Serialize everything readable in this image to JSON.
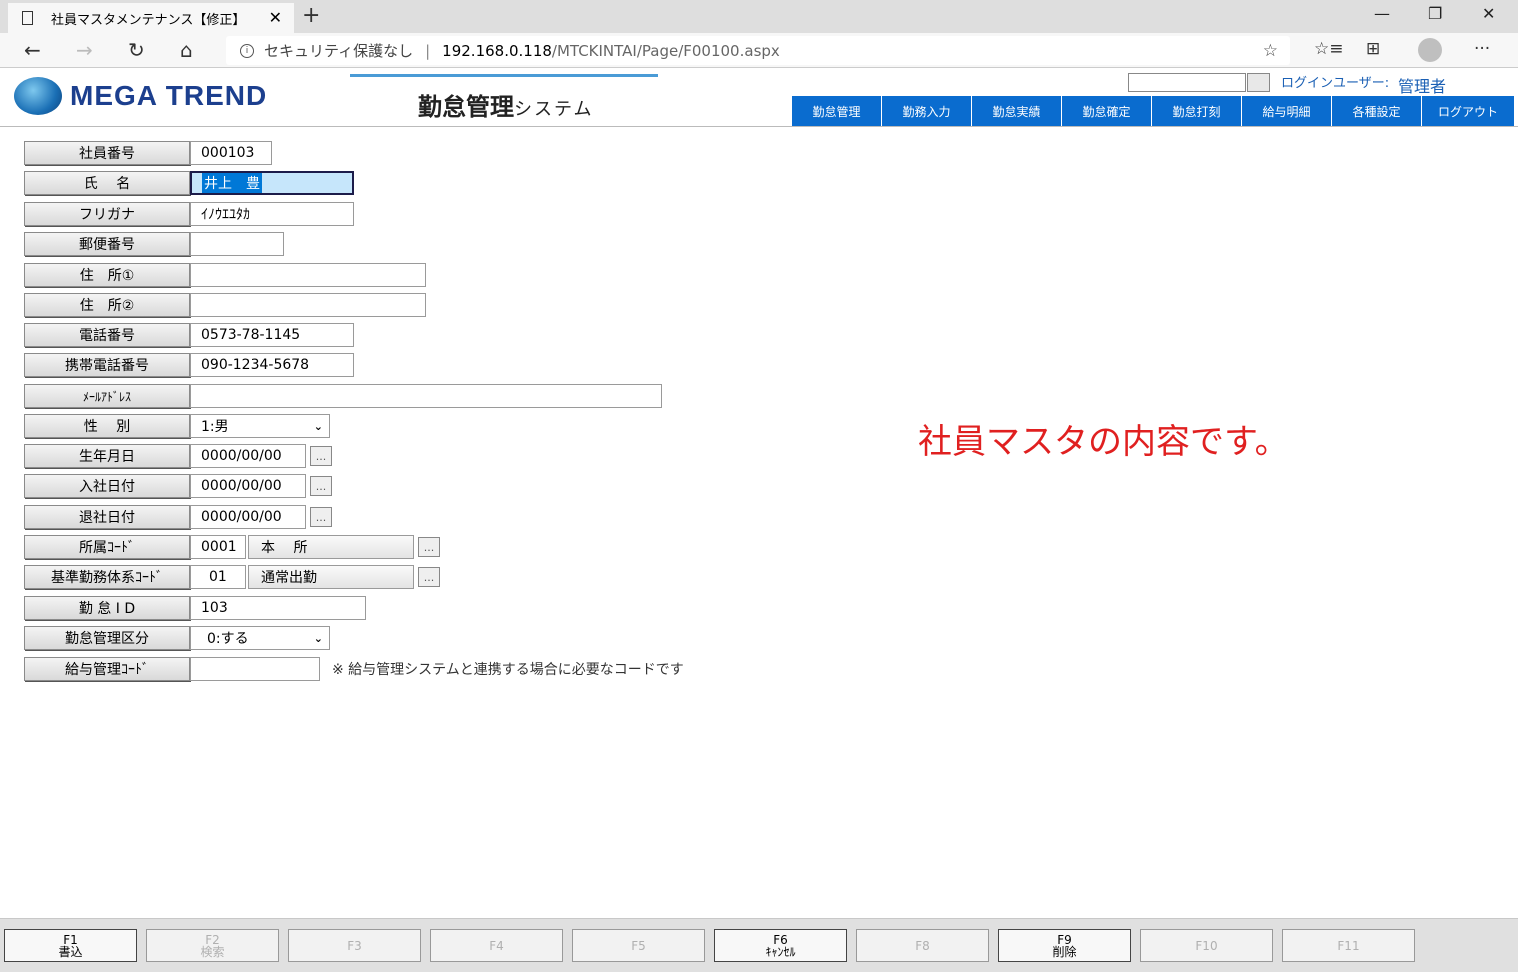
{
  "browser": {
    "tab_title": "社員マスタメンテナンス【修正】",
    "address_security": "セキュリティ保護なし",
    "address_host": "192.168.0.118",
    "address_path": "/MTCKINTAI/Page/F00100.aspx"
  },
  "header": {
    "logo_text": "MEGA TREND",
    "system_title": "勤怠管理",
    "system_sub": "システム",
    "login_label": "ログインユーザー:",
    "login_user": "管理者",
    "menu": [
      "勤怠管理",
      "勤務入力",
      "勤怠実績",
      "勤怠確定",
      "勤怠打刻",
      "給与明細",
      "各種設定",
      "ログアウト"
    ]
  },
  "form": {
    "employee_no": {
      "label": "社員番号",
      "value": "000103"
    },
    "name": {
      "label": "氏　 名",
      "value": "井上　豊"
    },
    "furigana": {
      "label": "フリガナ",
      "value": "ｲﾉｳｴﾕﾀｶ"
    },
    "postal": {
      "label": "郵便番号",
      "value": ""
    },
    "address1": {
      "label": "住　所①",
      "value": ""
    },
    "address2": {
      "label": "住　所②",
      "value": ""
    },
    "phone": {
      "label": "電話番号",
      "value": "0573-78-1145"
    },
    "mobile": {
      "label": "携帯電話番号",
      "value": "090-1234-5678"
    },
    "email": {
      "label": "ﾒｰﾙｱﾄﾞﾚｽ",
      "value": ""
    },
    "gender": {
      "label": "性　 別",
      "value": "1:男"
    },
    "birth": {
      "label": "生年月日",
      "value": "0000/00/00"
    },
    "hire": {
      "label": "入社日付",
      "value": "0000/00/00"
    },
    "retire": {
      "label": "退社日付",
      "value": "0000/00/00"
    },
    "dept": {
      "label": "所属ｺｰﾄﾞ",
      "code": "0001",
      "name": "本　 所"
    },
    "work_system": {
      "label": "基準勤務体系ｺｰﾄﾞ",
      "code": "01",
      "name": "通常出勤"
    },
    "kintai_id": {
      "label": "勤 怠 I D",
      "value": "103"
    },
    "kintai_kbn": {
      "label": "勤怠管理区分",
      "value": "0:する"
    },
    "payroll_code": {
      "label": "給与管理ｺｰﾄﾞ",
      "value": "",
      "note": "※ 給与管理システムと連携する場合に必要なコードです"
    }
  },
  "message": "社員マスタの内容です。",
  "fkeys": [
    {
      "key": "F1",
      "label": "書込",
      "enabled": true
    },
    {
      "key": "F2",
      "label": "検索",
      "enabled": false
    },
    {
      "key": "F3",
      "label": "",
      "enabled": false
    },
    {
      "key": "F4",
      "label": "",
      "enabled": false
    },
    {
      "key": "F5",
      "label": "",
      "enabled": false
    },
    {
      "key": "F6",
      "label": "ｷｬﾝｾﾙ",
      "enabled": true
    },
    {
      "key": "F8",
      "label": "",
      "enabled": false
    },
    {
      "key": "F9",
      "label": "削除",
      "enabled": true
    },
    {
      "key": "F10",
      "label": "",
      "enabled": false
    },
    {
      "key": "F11",
      "label": "",
      "enabled": false
    }
  ]
}
